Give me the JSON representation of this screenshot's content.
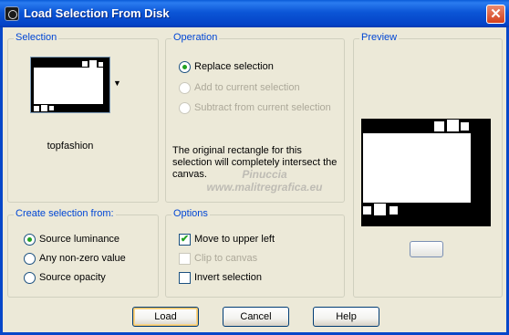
{
  "window": {
    "title": "Load Selection From Disk",
    "close_glyph": "✕"
  },
  "selection": {
    "label": "Selection",
    "thumbnail_name": "topfashion"
  },
  "operation": {
    "label": "Operation",
    "options": [
      {
        "label": "Replace selection",
        "selected": true,
        "enabled": true
      },
      {
        "label": "Add to current selection",
        "selected": false,
        "enabled": false
      },
      {
        "label": "Subtract from current selection",
        "selected": false,
        "enabled": false
      }
    ],
    "note": "The original rectangle for this selection will completely intersect the canvas."
  },
  "preview": {
    "label": "Preview"
  },
  "create_from": {
    "label": "Create selection from:",
    "options": [
      {
        "label": "Source luminance",
        "selected": true
      },
      {
        "label": "Any non-zero value",
        "selected": false
      },
      {
        "label": "Source opacity",
        "selected": false
      }
    ]
  },
  "options": {
    "label": "Options",
    "checks": [
      {
        "label": "Move to upper left",
        "checked": true,
        "enabled": true
      },
      {
        "label": "Clip to canvas",
        "checked": false,
        "enabled": false
      },
      {
        "label": "Invert selection",
        "checked": false,
        "enabled": true
      }
    ]
  },
  "buttons": {
    "load": "Load",
    "cancel": "Cancel",
    "help": "Help"
  },
  "watermark": {
    "line1": "Pinuccia",
    "line2": "www.malitregrafica.eu"
  },
  "colors": {
    "title_bar": "#0b55d6",
    "group_label": "#0046d5",
    "dialog_bg": "#ece9d8"
  }
}
